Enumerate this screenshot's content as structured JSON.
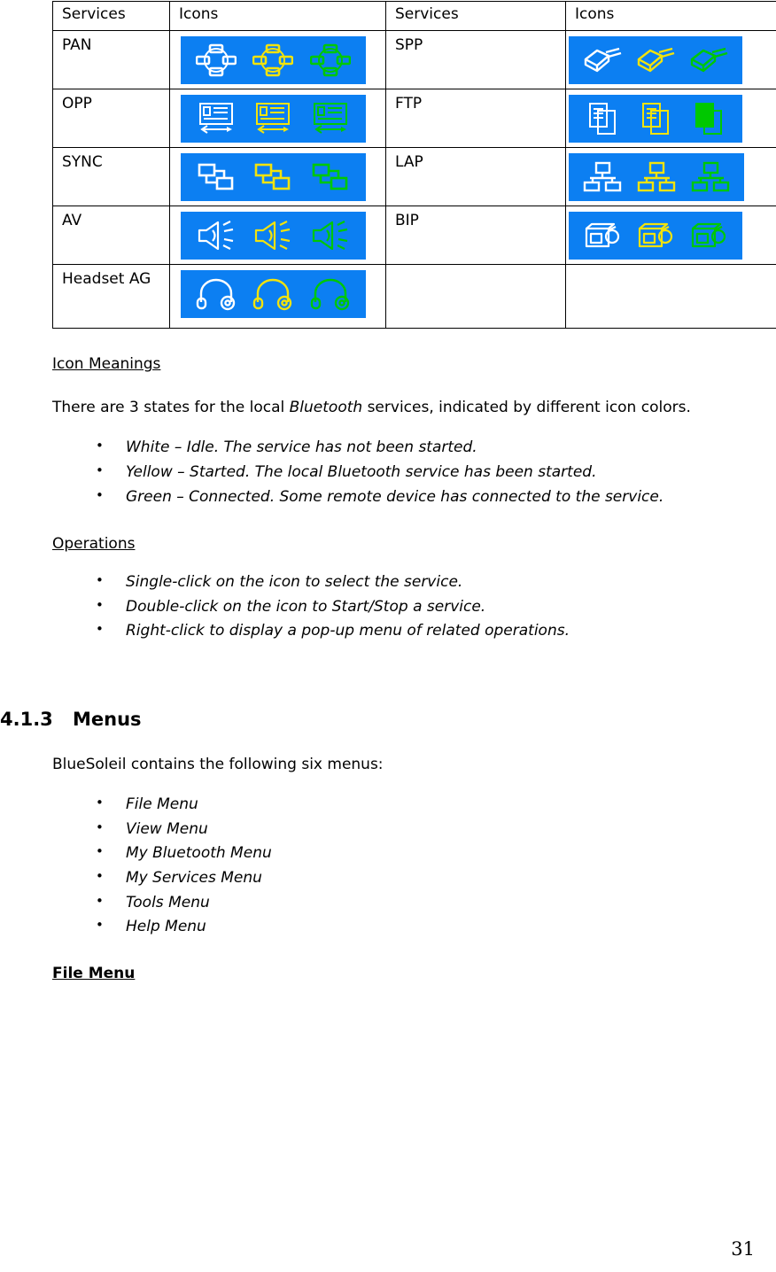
{
  "table": {
    "headers": [
      "Services",
      "Icons",
      "Services",
      "Icons"
    ],
    "rows": [
      {
        "left_label": "PAN",
        "left_icon": "pan-icon",
        "right_label": "SPP",
        "right_icon": "spp-icon"
      },
      {
        "left_label": "OPP",
        "left_icon": "opp-icon",
        "right_label": "FTP",
        "right_icon": "ftp-icon"
      },
      {
        "left_label": "SYNC",
        "left_icon": "sync-icon",
        "right_label": "LAP",
        "right_icon": "lap-icon"
      },
      {
        "left_label": "AV",
        "left_icon": "av-icon",
        "right_label": "BIP",
        "right_icon": "bip-icon"
      },
      {
        "left_label": "Headset AG",
        "left_icon": "headset-ag-icon",
        "right_label": "",
        "right_icon": ""
      }
    ],
    "icon_states": [
      "white",
      "yellow",
      "green"
    ],
    "colors": {
      "icon_background": "#0c7ff2",
      "state_white": "#ffffff",
      "state_yellow": "#f2e30c",
      "state_green": "#00c800",
      "border": "#000000"
    }
  },
  "icon_meanings": {
    "heading": "Icon Meanings",
    "intro_part1": "There are 3 states for the local ",
    "intro_italic": "Bluetooth",
    "intro_part2": " services, indicated by different icon colors.",
    "bullets": [
      "White – Idle. The service has not been started.",
      "Yellow – Started. The local Bluetooth service has been started.",
      "Green – Connected. Some remote device has connected to the service."
    ]
  },
  "operations": {
    "heading": "Operations",
    "bullets": [
      "Single-click on the icon to select the service.",
      "Double-click on the icon to Start/Stop a service.",
      "Right-click to display a pop-up menu of related operations."
    ]
  },
  "menus_section": {
    "number": "4.1.3",
    "title": "Menus",
    "intro": "BlueSoleil contains the following six menus:",
    "bullets": [
      "File Menu",
      "View Menu",
      "My Bluetooth Menu",
      "My Services Menu",
      "Tools Menu",
      "Help Menu"
    ],
    "subheading": "File Menu"
  },
  "footer": {
    "page_number": "31"
  }
}
